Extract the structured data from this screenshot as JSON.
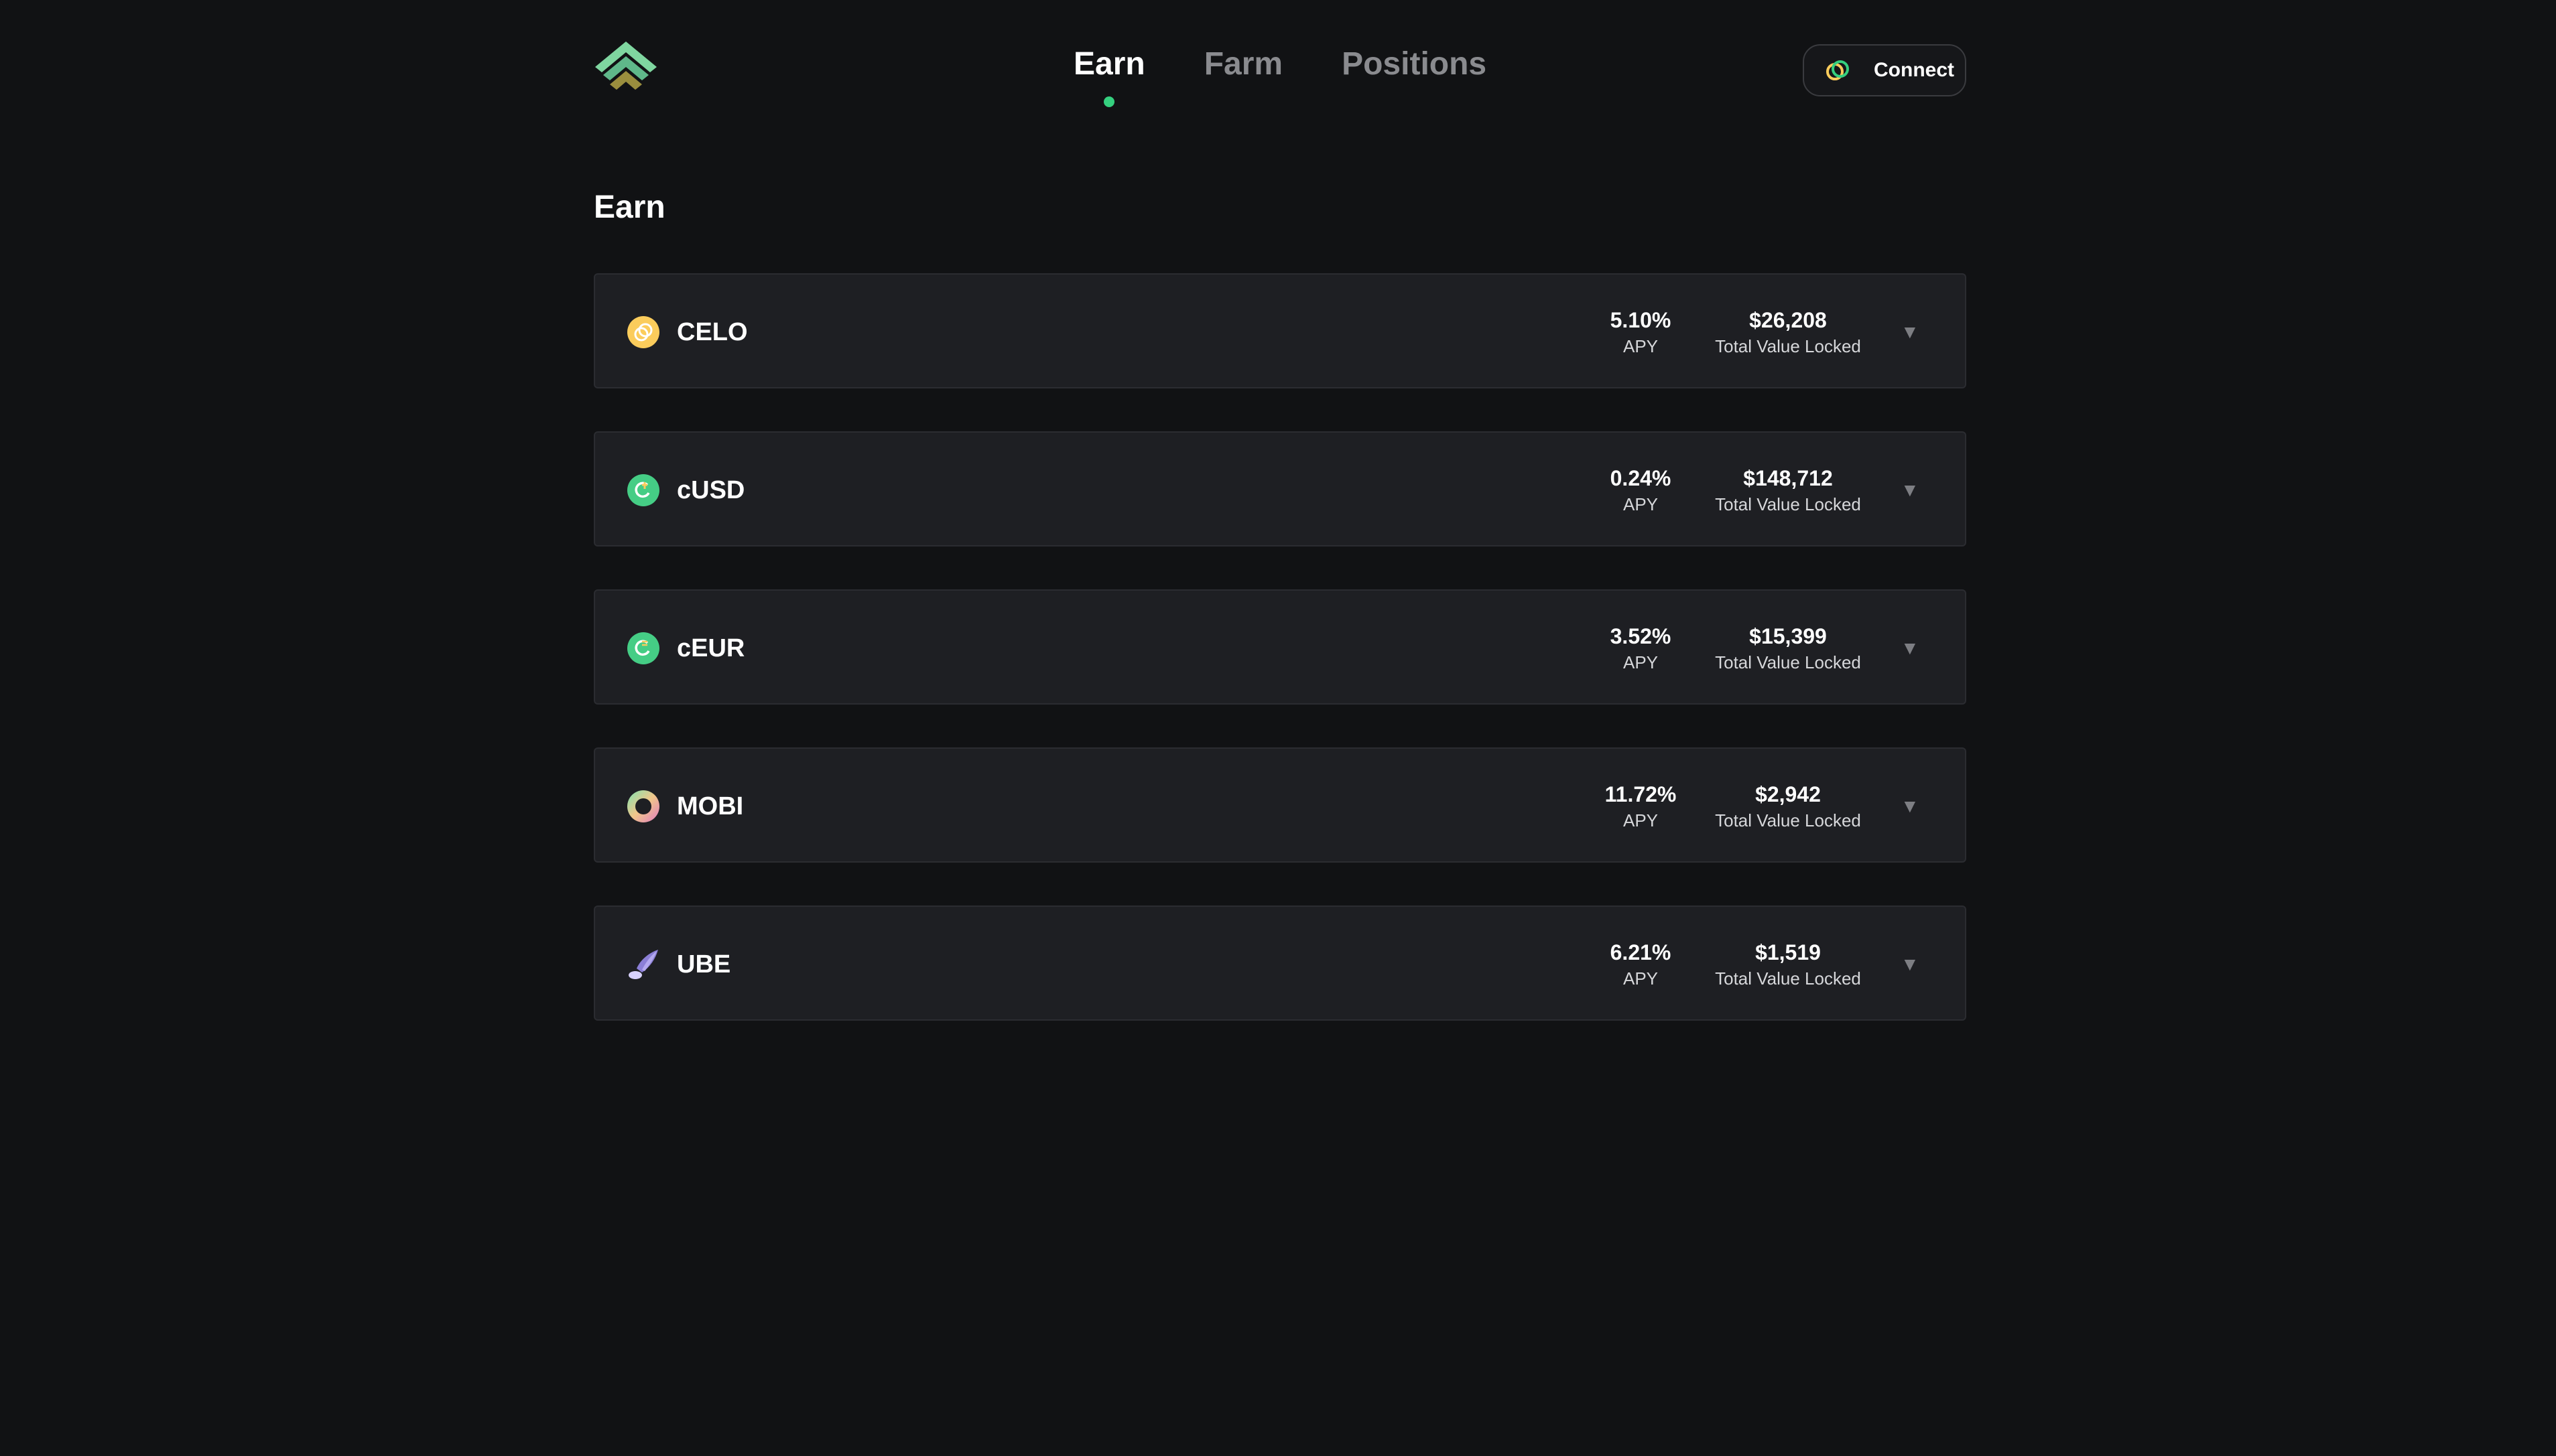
{
  "nav": {
    "tabs": [
      {
        "label": "Earn",
        "active": true
      },
      {
        "label": "Farm",
        "active": false
      },
      {
        "label": "Positions",
        "active": false
      }
    ],
    "connect_label": "Connect"
  },
  "page": {
    "title": "Earn"
  },
  "pools": [
    {
      "name": "CELO",
      "icon": "celo-icon",
      "apy": "5.10%",
      "apy_label": "APY",
      "tvl": "$26,208",
      "tvl_label": "Total Value Locked"
    },
    {
      "name": "cUSD",
      "icon": "cusd-icon",
      "apy": "0.24%",
      "apy_label": "APY",
      "tvl": "$148,712",
      "tvl_label": "Total Value Locked"
    },
    {
      "name": "cEUR",
      "icon": "ceur-icon",
      "apy": "3.52%",
      "apy_label": "APY",
      "tvl": "$15,399",
      "tvl_label": "Total Value Locked"
    },
    {
      "name": "MOBI",
      "icon": "mobi-icon",
      "apy": "11.72%",
      "apy_label": "APY",
      "tvl": "$2,942",
      "tvl_label": "Total Value Locked"
    },
    {
      "name": "UBE",
      "icon": "ube-icon",
      "apy": "6.21%",
      "apy_label": "APY",
      "tvl": "$1,519",
      "tvl_label": "Total Value Locked"
    }
  ],
  "colors": {
    "background": "#111214",
    "card": "#1e1f23",
    "accent": "#35d07f",
    "celo_gold": "#fbcc5c"
  }
}
